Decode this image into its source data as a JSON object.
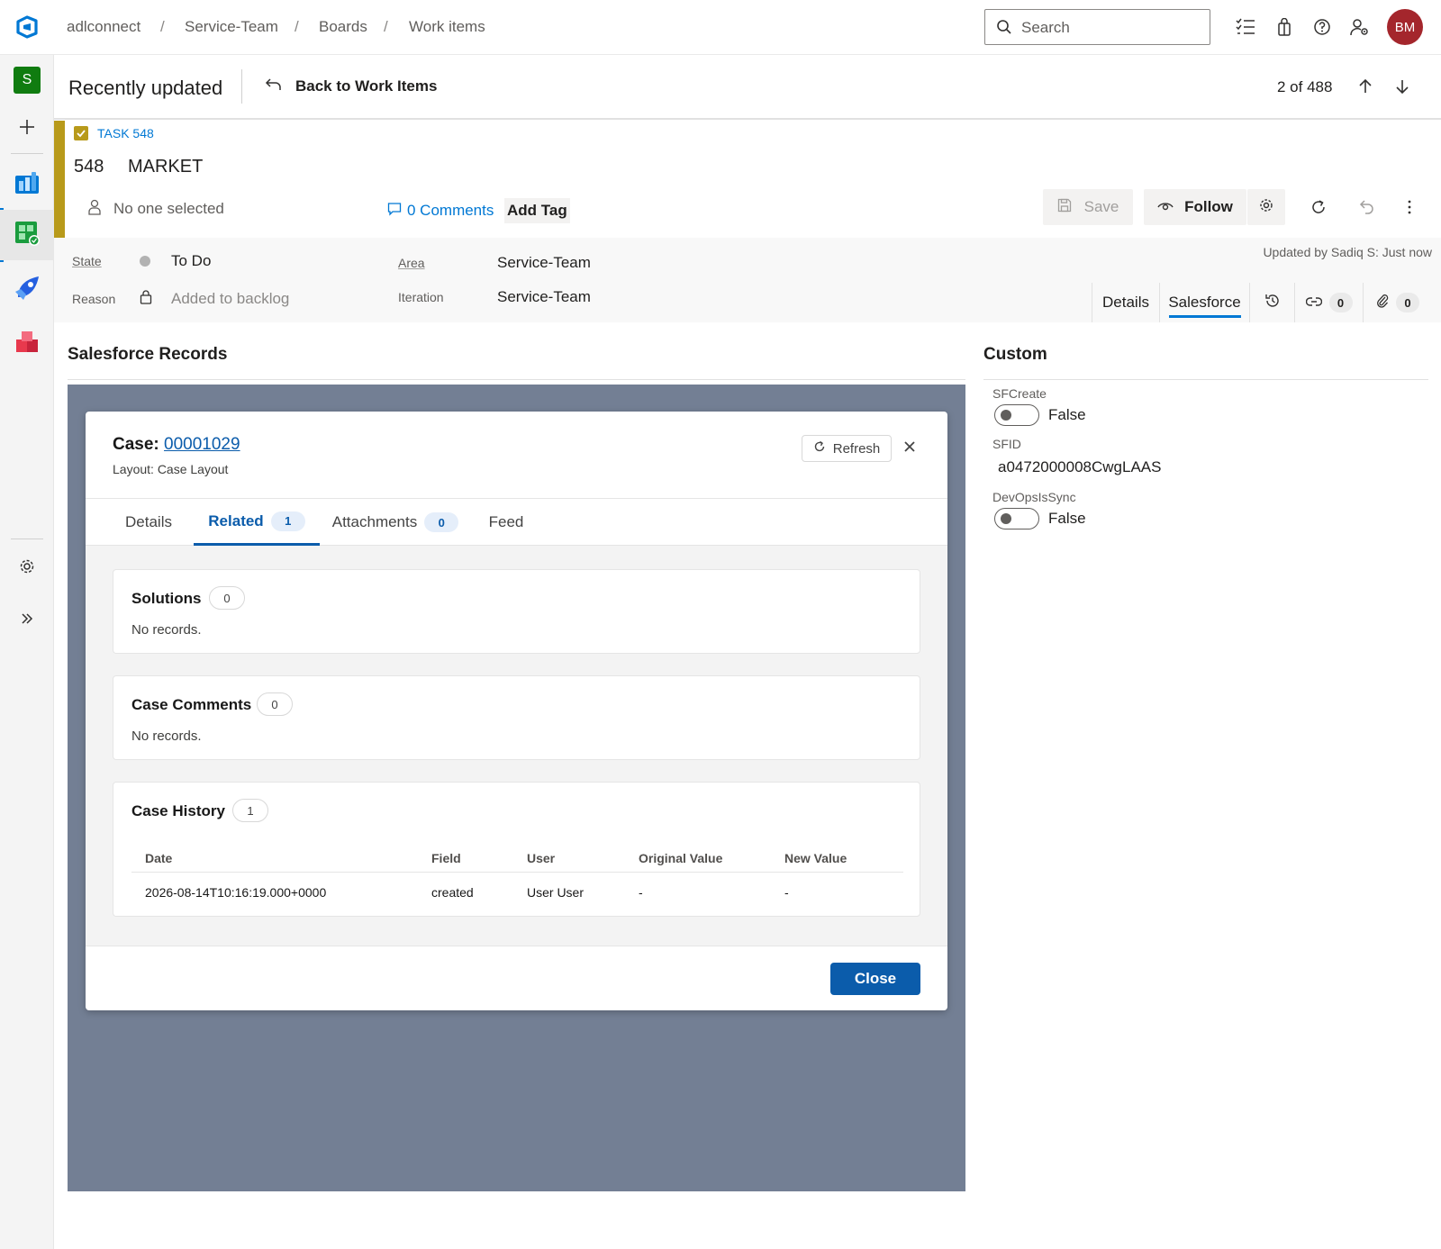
{
  "breadcrumb": [
    "adlconnect",
    "Service-Team",
    "Boards",
    "Work items"
  ],
  "search": {
    "placeholder": "Search"
  },
  "user": {
    "initials": "BM"
  },
  "project": {
    "initial": "S"
  },
  "header": {
    "title": "Recently updated",
    "back_label": "Back to Work Items",
    "position": "2 of 488"
  },
  "work_item": {
    "type_label": "TASK 548",
    "id": "548",
    "title": "MARKET",
    "assigned": "No one selected",
    "comments": "0 Comments",
    "add_tag": "Add Tag",
    "save_label": "Save",
    "follow_label": "Follow",
    "updated": "Updated by Sadiq S: Just now",
    "state_label": "State",
    "state_value": "To Do",
    "reason_label": "Reason",
    "reason_value": "Added to backlog",
    "area_label": "Area",
    "area_value": "Service-Team",
    "iteration_label": "Iteration",
    "iteration_value": "Service-Team",
    "tabs": {
      "details": "Details",
      "salesforce": "Salesforce",
      "links_count": "0",
      "attachments_count": "0"
    },
    "colors": {
      "task": "#b89a1a",
      "accent": "#0078d4"
    }
  },
  "salesforce": {
    "section_title": "Salesforce Records",
    "modal": {
      "case_prefix": "Case: ",
      "case_number": "00001029",
      "layout": "Layout: Case Layout",
      "refresh_label": "Refresh",
      "tabs": [
        {
          "label": "Details"
        },
        {
          "label": "Related",
          "count": "1"
        },
        {
          "label": "Attachments",
          "count": "0"
        },
        {
          "label": "Feed"
        }
      ],
      "solutions": {
        "title": "Solutions",
        "count": "0",
        "empty": "No records."
      },
      "case_comments": {
        "title": "Case Comments",
        "count": "0",
        "empty": "No records."
      },
      "case_history": {
        "title": "Case History",
        "count": "1",
        "columns": [
          "Date",
          "Field",
          "User",
          "Original Value",
          "New Value"
        ],
        "rows": [
          [
            "2026-08-14T10:16:19.000+0000",
            "created",
            "User User",
            "-",
            "-"
          ]
        ]
      },
      "close_label": "Close"
    }
  },
  "custom": {
    "title": "Custom",
    "sfcreate_label": "SFCreate",
    "sfcreate_value": "False",
    "sfid_label": "SFID",
    "sfid_value": "a0472000008CwgLAAS",
    "devops_label": "DevOpsIsSync",
    "devops_value": "False"
  }
}
